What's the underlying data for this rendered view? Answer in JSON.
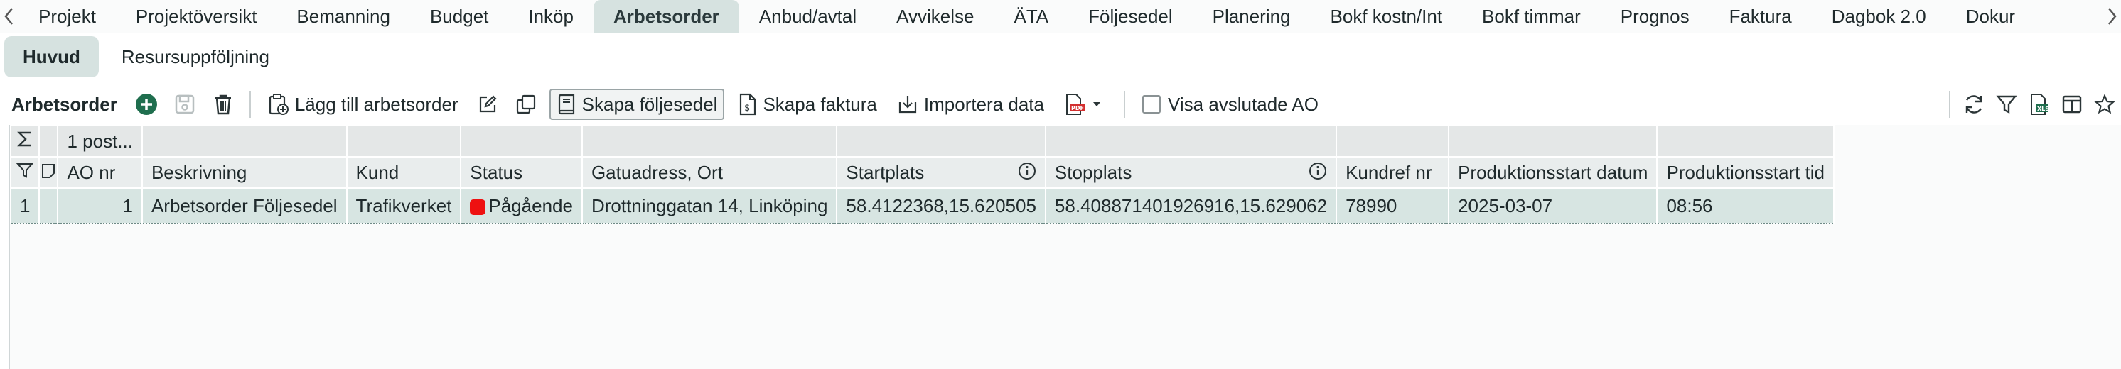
{
  "tabs": [
    "Projekt",
    "Projektöversikt",
    "Bemanning",
    "Budget",
    "Inköp",
    "Arbetsorder",
    "Anbud/avtal",
    "Avvikelse",
    "ÄTA",
    "Följesedel",
    "Planering",
    "Bokf kostn/Int",
    "Bokf timmar",
    "Prognos",
    "Faktura",
    "Dagbok 2.0",
    "Dokur"
  ],
  "active_tab": "Arbetsorder",
  "subtabs": {
    "main": "Huvud",
    "resources": "Resursuppföljning"
  },
  "toolbar": {
    "title": "Arbetsorder",
    "add_work_order": "Lägg till arbetsorder",
    "create_delivery_note": "Skapa följesedel",
    "create_invoice": "Skapa faktura",
    "import_data": "Importera data",
    "show_finished": "Visa avslutade AO"
  },
  "grid": {
    "sum_label": "1 post...",
    "columns": {
      "ao_nr": "AO nr",
      "description": "Beskrivning",
      "customer": "Kund",
      "status": "Status",
      "address": "Gatuadress, Ort",
      "start_location": "Startplats",
      "stop_location": "Stopplats",
      "customer_ref": "Kundref nr",
      "prod_start_date": "Produktionsstart datum",
      "prod_start_time": "Produktionsstart tid"
    },
    "rows": [
      {
        "index": "1",
        "ao_nr": "1",
        "description": "Arbetsorder Följesedel",
        "customer": "Trafikverket",
        "status": "Pågående",
        "address": "Drottninggatan 14, Linköping",
        "start_location": "58.4122368,15.620505",
        "stop_location": "58.408871401926916,15.629062",
        "customer_ref": "78990",
        "prod_start_date": "2025-03-07",
        "prod_start_time": "08:56"
      }
    ]
  },
  "colors": {
    "accent": "#d6e2e0",
    "add_green": "#1f6e4e",
    "status_red": "#ee1111",
    "pdf_red": "#d32f2f"
  }
}
